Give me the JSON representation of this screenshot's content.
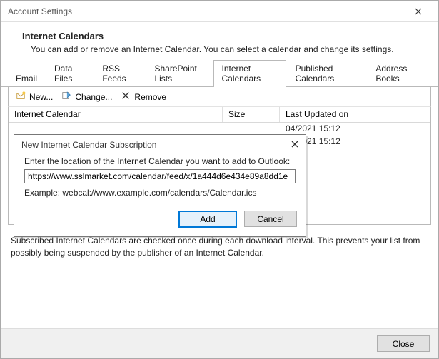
{
  "window": {
    "title": "Account Settings",
    "close_button_label": "Close"
  },
  "header": {
    "title": "Internet Calendars",
    "subtitle": "You can add or remove an Internet Calendar. You can select a calendar and change its settings."
  },
  "tabs": [
    {
      "label": "Email"
    },
    {
      "label": "Data Files"
    },
    {
      "label": "RSS Feeds"
    },
    {
      "label": "SharePoint Lists"
    },
    {
      "label": "Internet Calendars",
      "active": true
    },
    {
      "label": "Published Calendars"
    },
    {
      "label": "Address Books"
    }
  ],
  "toolbar": {
    "new_label": "New...",
    "change_label": "Change...",
    "remove_label": "Remove"
  },
  "grid": {
    "columns": {
      "name": "Internet Calendar",
      "size": "Size",
      "updated": "Last Updated on"
    },
    "rows": [
      {
        "name": "",
        "size": "",
        "updated": "04/2021 15:12"
      },
      {
        "name": "",
        "size": "",
        "updated": "04/2021 15:12"
      }
    ]
  },
  "footnote": "Subscribed Internet Calendars are checked once during each download interval. This prevents your list from possibly being suspended by the publisher of an Internet Calendar.",
  "modal": {
    "title": "New Internet Calendar Subscription",
    "prompt": "Enter the location of the Internet Calendar you want to add to Outlook:",
    "input_value": "https://www.sslmarket.com/calendar/feed/x/1a444d6e434e89a8dd1e",
    "example": "Example: webcal://www.example.com/calendars/Calendar.ics",
    "add_label": "Add",
    "cancel_label": "Cancel"
  }
}
